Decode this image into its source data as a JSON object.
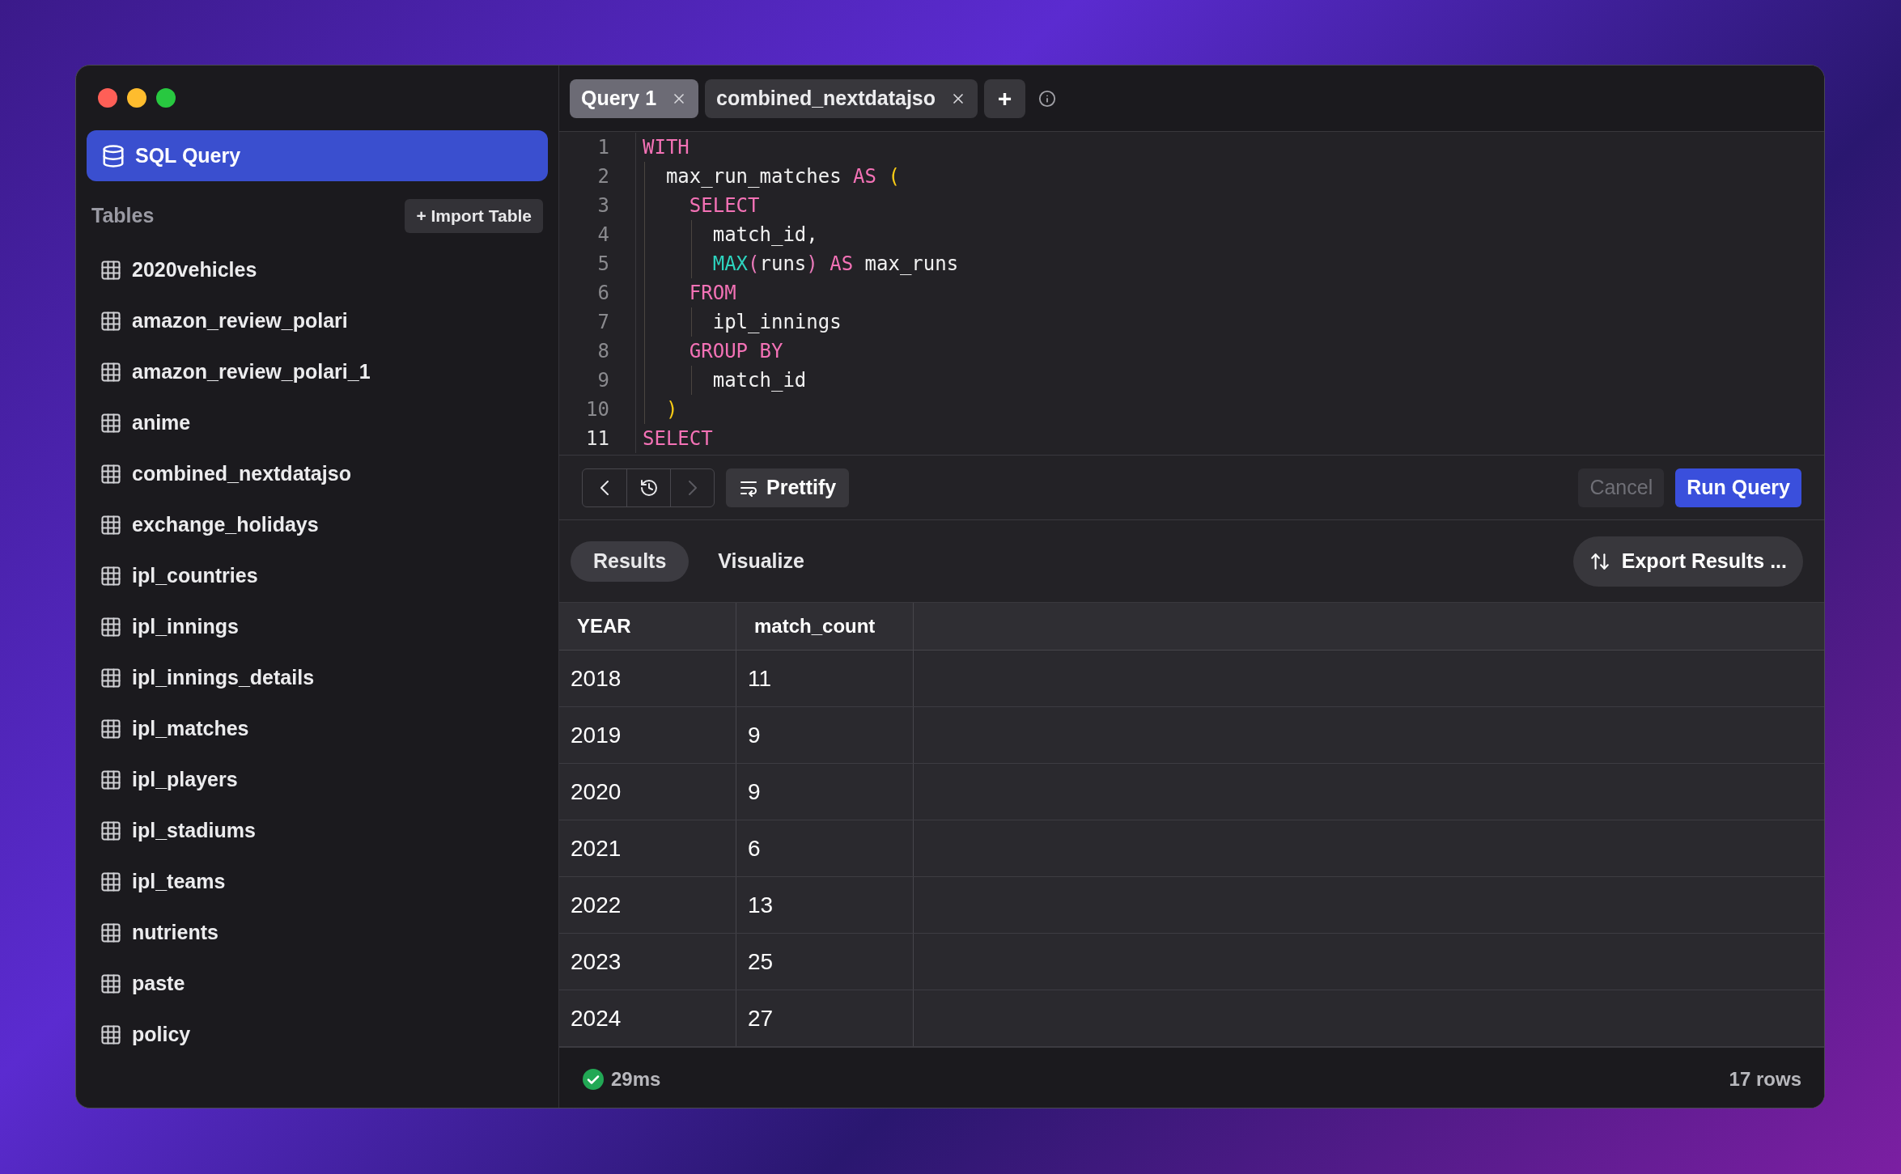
{
  "sidebar": {
    "nav_item": {
      "label": "SQL Query",
      "selected": true
    },
    "section_title": "Tables",
    "import_button": "+ Import Table",
    "tables": [
      "2020vehicles",
      "amazon_review_polari",
      "amazon_review_polari_1",
      "anime",
      "combined_nextdatajso",
      "exchange_holidays",
      "ipl_countries",
      "ipl_innings",
      "ipl_innings_details",
      "ipl_matches",
      "ipl_players",
      "ipl_stadiums",
      "ipl_teams",
      "nutrients",
      "paste",
      "policy"
    ]
  },
  "tabs": [
    {
      "label": "Query 1",
      "selected": true
    },
    {
      "label": "combined_nextdatajso",
      "selected": false
    }
  ],
  "add_tab_button": "+",
  "editor": {
    "lines": [
      {
        "number": "1",
        "current": false,
        "tokens": [
          {
            "kind": "keyword",
            "text": "WITH"
          }
        ]
      },
      {
        "number": "2",
        "current": false,
        "tokens": [
          {
            "kind": "plain",
            "text": "  max_run_matches "
          },
          {
            "kind": "keyword",
            "text": "AS"
          },
          {
            "kind": "bracket",
            "text": " ("
          }
        ]
      },
      {
        "number": "3",
        "current": false,
        "tokens": [
          {
            "kind": "keyword",
            "text": "    SELECT"
          }
        ]
      },
      {
        "number": "4",
        "current": false,
        "tokens": [
          {
            "kind": "plain",
            "text": "      match_id,"
          }
        ]
      },
      {
        "number": "5",
        "current": false,
        "tokens": [
          {
            "kind": "function",
            "text": "      MAX"
          },
          {
            "kind": "call_paren",
            "text": "("
          },
          {
            "kind": "plain",
            "text": "runs"
          },
          {
            "kind": "call_paren",
            "text": ")"
          },
          {
            "kind": "keyword",
            "text": " AS"
          },
          {
            "kind": "plain",
            "text": " max_runs"
          }
        ]
      },
      {
        "number": "6",
        "current": false,
        "tokens": [
          {
            "kind": "keyword",
            "text": "    FROM"
          }
        ]
      },
      {
        "number": "7",
        "current": false,
        "tokens": [
          {
            "kind": "plain",
            "text": "      ipl_innings"
          }
        ]
      },
      {
        "number": "8",
        "current": false,
        "tokens": [
          {
            "kind": "keyword",
            "text": "    GROUP BY"
          }
        ]
      },
      {
        "number": "9",
        "current": false,
        "tokens": [
          {
            "kind": "plain",
            "text": "      match_id"
          }
        ]
      },
      {
        "number": "10",
        "current": false,
        "tokens": [
          {
            "kind": "bracket",
            "text": "  )"
          }
        ]
      },
      {
        "number": "11",
        "current": true,
        "tokens": [
          {
            "kind": "keyword",
            "text": "SELECT"
          }
        ]
      }
    ]
  },
  "toolbar": {
    "history_nav": [
      {
        "kind": "back",
        "disabled": false
      },
      {
        "kind": "history",
        "disabled": false
      },
      {
        "kind": "forward",
        "disabled": true
      }
    ],
    "prettify_button": "Prettify",
    "cancel_button": {
      "label": "Cancel",
      "disabled": true
    },
    "run_button": "Run Query"
  },
  "result_tabs": [
    {
      "label": "Results",
      "selected": true
    },
    {
      "label": "Visualize",
      "selected": false
    }
  ],
  "export_button": "Export Results ...",
  "table": {
    "columns": [
      "YEAR",
      "match_count"
    ],
    "rows": [
      [
        "2018",
        "11"
      ],
      [
        "2019",
        "9"
      ],
      [
        "2020",
        "9"
      ],
      [
        "2021",
        "6"
      ],
      [
        "2022",
        "13"
      ],
      [
        "2023",
        "25"
      ],
      [
        "2024",
        "27"
      ]
    ]
  },
  "status_bar": {
    "success": true,
    "duration": "29ms",
    "row_count": "17 rows"
  }
}
